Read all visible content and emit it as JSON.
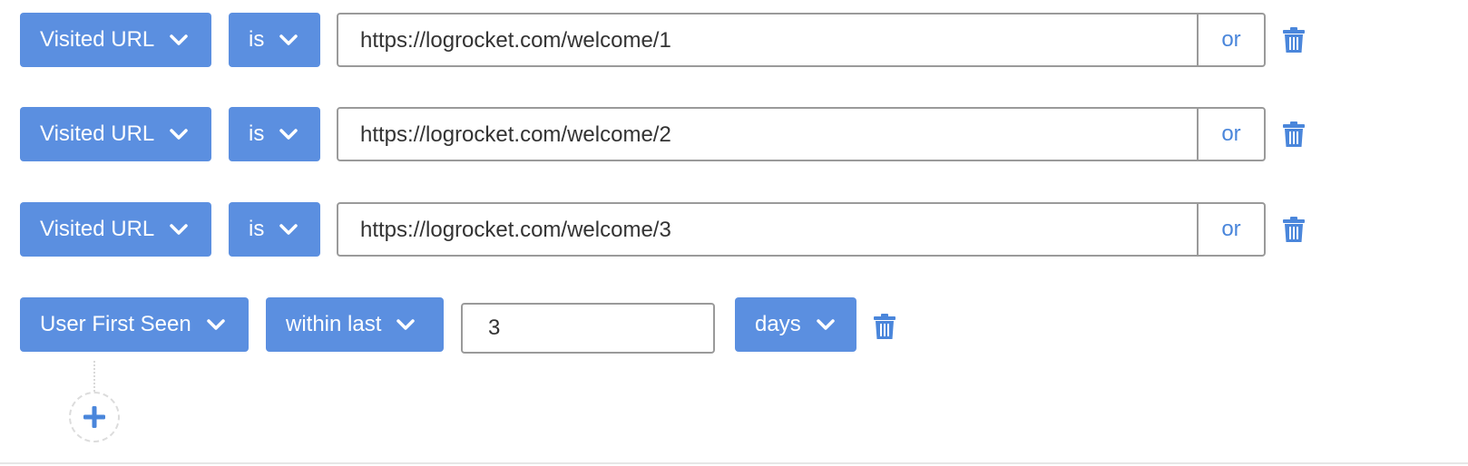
{
  "colors": {
    "accent": "#5b8fe0",
    "link": "#4a86db",
    "border": "#9a9a9a"
  },
  "rows": [
    {
      "field": "Visited URL",
      "operator": "is",
      "value": "https://logrocket.com/welcome/1",
      "or_label": "or"
    },
    {
      "field": "Visited URL",
      "operator": "is",
      "value": "https://logrocket.com/welcome/2",
      "or_label": "or"
    },
    {
      "field": "Visited URL",
      "operator": "is",
      "value": "https://logrocket.com/welcome/3",
      "or_label": "or"
    }
  ],
  "first_seen": {
    "field": "User First Seen",
    "operator": "within last",
    "value": "3",
    "unit": "days"
  },
  "icons": {
    "chevron": "chevron-down-icon",
    "trash": "trash-icon",
    "add": "plus-icon"
  }
}
